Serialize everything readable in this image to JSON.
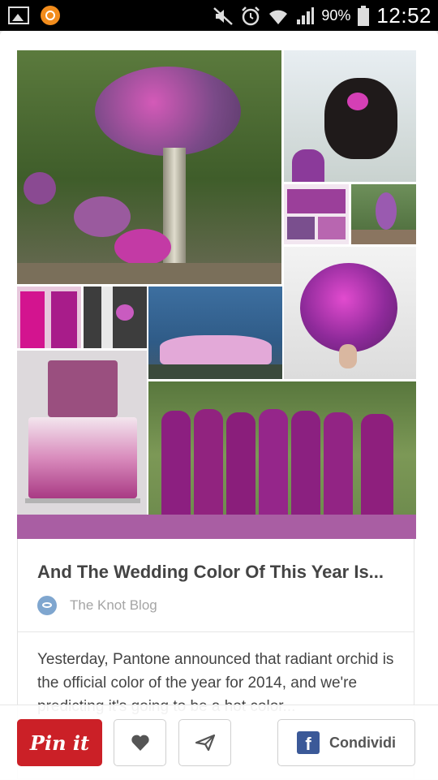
{
  "status_bar": {
    "battery_percent": "90%",
    "time": "12:52",
    "icons": [
      "gallery-icon",
      "app-notification-icon",
      "mute-icon",
      "alarm-icon",
      "wifi-icon",
      "signal-icon",
      "battery-icon"
    ]
  },
  "pin": {
    "image_description_tiles": [
      "centerpiece-flowers",
      "bride-hair-orchid",
      "invitation-cards",
      "outdoor-reception",
      "bouquet",
      "bridesmaid-dresses",
      "groom-boutonniere",
      "tent-venue",
      "ombre-cake",
      "bridesmaids-group"
    ],
    "title": "And The Wedding Color Of This Year Is...",
    "source": "The Knot Blog",
    "description": "Yesterday, Pantone announced that radiant orchid is the official color of the year for 2014, and we're predicting it's going to be a hot color..."
  },
  "actions": {
    "pin_label": "Pin it",
    "like_icon": "heart-icon",
    "send_icon": "send-icon",
    "share_label": "Condividi",
    "share_icon": "facebook-icon"
  },
  "colors": {
    "accent": "#a95ea3",
    "pin_red": "#cb2027",
    "facebook_blue": "#3b5998"
  }
}
